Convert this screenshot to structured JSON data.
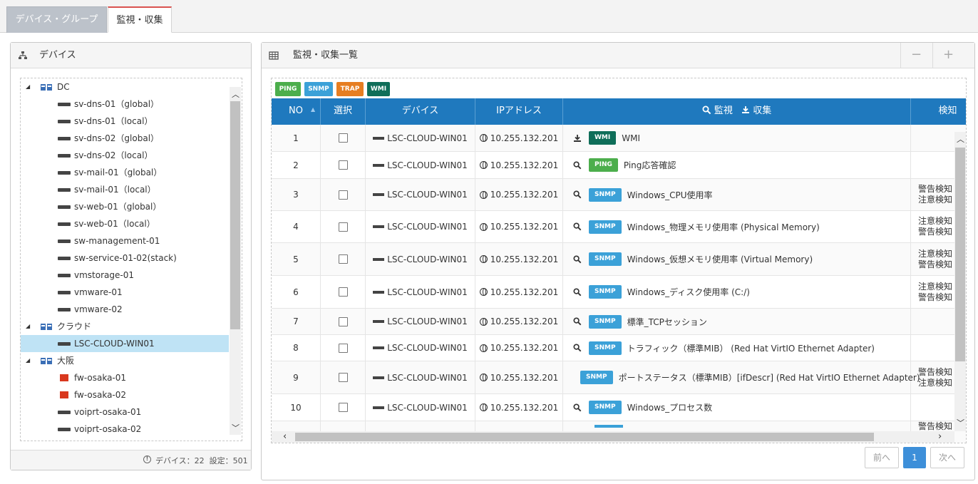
{
  "tabs": [
    "デバイス・グループ",
    "監視・収集"
  ],
  "left_panel": {
    "title": "デバイス",
    "footer": "デバイス：22  設定：501",
    "tree": [
      {
        "type": "group",
        "label": "DC"
      },
      {
        "type": "device",
        "label": "sv-dns-01（global）"
      },
      {
        "type": "device",
        "label": "sv-dns-01（local）"
      },
      {
        "type": "device",
        "label": "sv-dns-02（global）"
      },
      {
        "type": "device",
        "label": "sv-dns-02（local）"
      },
      {
        "type": "device",
        "label": "sv-mail-01（global）"
      },
      {
        "type": "device",
        "label": "sv-mail-01（local）"
      },
      {
        "type": "device",
        "label": "sv-web-01（global）"
      },
      {
        "type": "device",
        "label": "sv-web-01（local）"
      },
      {
        "type": "device",
        "label": "sw-management-01"
      },
      {
        "type": "device",
        "label": "sw-service-01-02(stack)"
      },
      {
        "type": "device",
        "label": "vmstorage-01"
      },
      {
        "type": "device",
        "label": "vmware-01"
      },
      {
        "type": "device",
        "label": "vmware-02"
      },
      {
        "type": "group",
        "label": "クラウド"
      },
      {
        "type": "device",
        "label": "LSC-CLOUD-WIN01",
        "selected": true
      },
      {
        "type": "group",
        "label": "大阪"
      },
      {
        "type": "firewall",
        "label": "fw-osaka-01"
      },
      {
        "type": "firewall",
        "label": "fw-osaka-02"
      },
      {
        "type": "device",
        "label": "voiprt-osaka-01"
      },
      {
        "type": "device",
        "label": "voiprt-osaka-02"
      }
    ]
  },
  "right_panel": {
    "title": "監視・収集一覧",
    "minus": "−",
    "plus": "+",
    "filters": [
      "PING",
      "SNMP",
      "TRAP",
      "WMI"
    ],
    "columns": {
      "no": "NO",
      "select": "選択",
      "device": "デバイス",
      "ip": "IPアドレス",
      "monitor": "監視",
      "collect": "収集",
      "detect": "検知"
    },
    "rows": [
      {
        "no": "1",
        "device": "LSC-CLOUD-WIN01",
        "ip": "10.255.132.201",
        "mode": "collect",
        "proto": "WMI",
        "item": "WMI",
        "detect": []
      },
      {
        "no": "2",
        "device": "LSC-CLOUD-WIN01",
        "ip": "10.255.132.201",
        "mode": "monitor",
        "proto": "PING",
        "item": "Ping応答確認",
        "detect": []
      },
      {
        "no": "3",
        "device": "LSC-CLOUD-WIN01",
        "ip": "10.255.132.201",
        "mode": "monitor",
        "proto": "SNMP",
        "item": "Windows_CPU使用率",
        "detect": [
          "警告検知",
          "注意検知"
        ]
      },
      {
        "no": "4",
        "device": "LSC-CLOUD-WIN01",
        "ip": "10.255.132.201",
        "mode": "monitor",
        "proto": "SNMP",
        "item": "Windows_物理メモリ使用率 (Physical Memory)",
        "detect": [
          "注意検知",
          "警告検知"
        ]
      },
      {
        "no": "5",
        "device": "LSC-CLOUD-WIN01",
        "ip": "10.255.132.201",
        "mode": "monitor",
        "proto": "SNMP",
        "item": "Windows_仮想メモリ使用率 (Virtual Memory)",
        "detect": [
          "注意検知",
          "警告検知"
        ]
      },
      {
        "no": "6",
        "device": "LSC-CLOUD-WIN01",
        "ip": "10.255.132.201",
        "mode": "monitor",
        "proto": "SNMP",
        "item": "Windows_ディスク使用率 (C:/)",
        "detect": [
          "注意検知",
          "警告検知"
        ]
      },
      {
        "no": "7",
        "device": "LSC-CLOUD-WIN01",
        "ip": "10.255.132.201",
        "mode": "monitor",
        "proto": "SNMP",
        "item": "標準_TCPセッション",
        "detect": []
      },
      {
        "no": "8",
        "device": "LSC-CLOUD-WIN01",
        "ip": "10.255.132.201",
        "mode": "monitor",
        "proto": "SNMP",
        "item": "トラフィック（標準MIB） (Red Hat VirtIO Ethernet Adapter)",
        "detect": []
      },
      {
        "no": "9",
        "device": "LSC-CLOUD-WIN01",
        "ip": "10.255.132.201",
        "mode": "monitor",
        "proto": "SNMP",
        "item": "ポートステータス（標準MIB）[ifDescr] (Red Hat VirtIO Ethernet Adapter)",
        "detect": [
          "警告検知",
          "注意検知"
        ]
      },
      {
        "no": "10",
        "device": "LSC-CLOUD-WIN01",
        "ip": "10.255.132.201",
        "mode": "monitor",
        "proto": "SNMP",
        "item": "Windows_プロセス数",
        "detect": []
      },
      {
        "no": "",
        "device": "",
        "ip": "",
        "mode": "",
        "proto": "",
        "item": "",
        "detect": [
          "警告検知"
        ]
      }
    ],
    "pagination": {
      "prev": "前へ",
      "page": "1",
      "next": "次へ"
    }
  }
}
